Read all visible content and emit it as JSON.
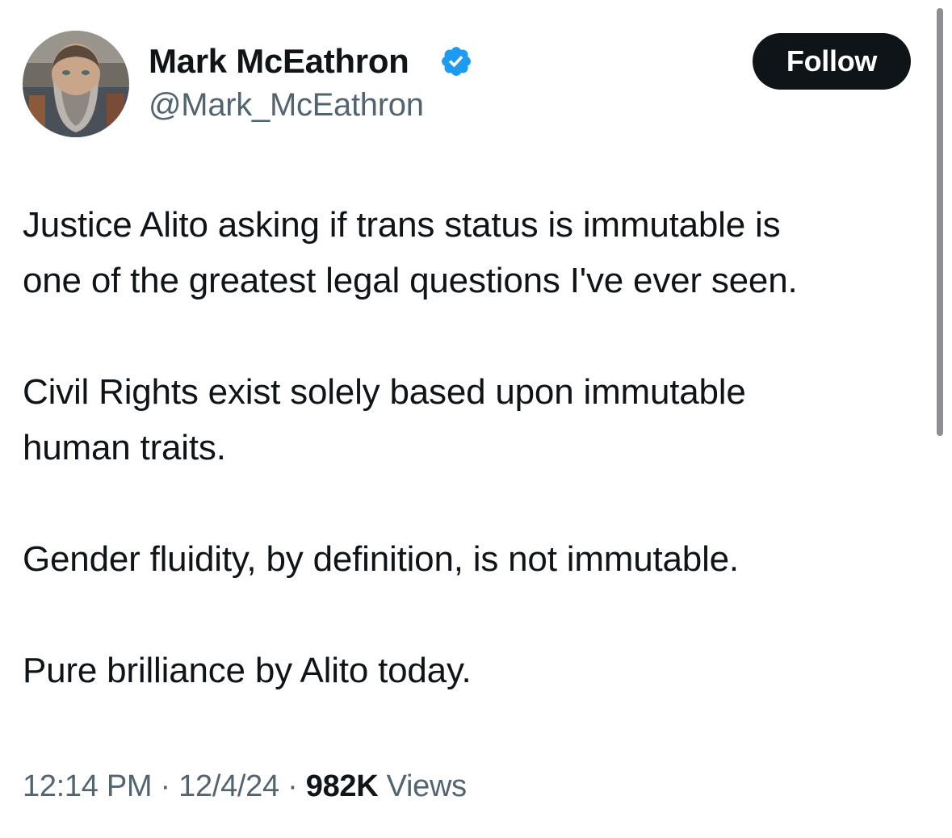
{
  "author": {
    "display_name": "Mark McEathron",
    "handle": "@Mark_McEathron",
    "verified": true,
    "avatar_icon": "avatar-photo"
  },
  "actions": {
    "follow_label": "Follow"
  },
  "tweet": {
    "paragraphs": [
      "Justice Alito asking if trans status is immutable is\none of the greatest legal questions I've ever seen.",
      "Civil Rights exist solely based upon immutable\nhuman traits.",
      "Gender fluidity, by definition, is not immutable.",
      "Pure brilliance by Alito today."
    ]
  },
  "meta": {
    "time": "12:14 PM",
    "separator": "·",
    "date": "12/4/24",
    "views_count": "982K",
    "views_label": "Views"
  },
  "colors": {
    "text_primary": "#0f1419",
    "text_secondary": "#536471",
    "verified_blue": "#1d9bf0",
    "button_bg": "#0f1419",
    "background": "#ffffff"
  }
}
